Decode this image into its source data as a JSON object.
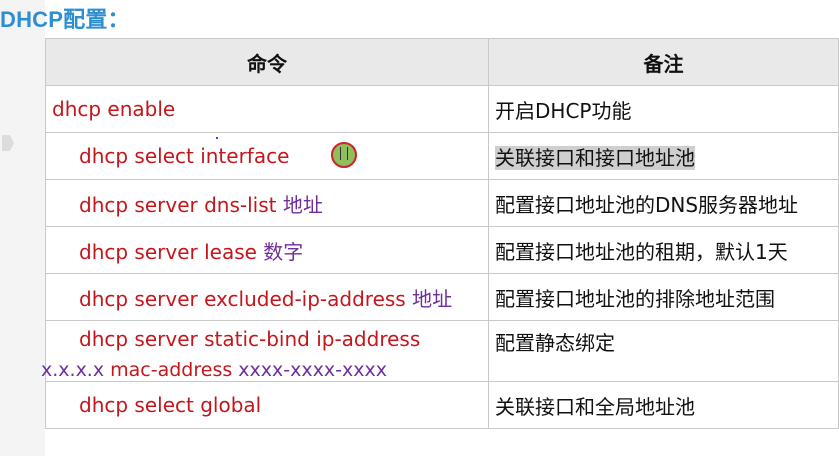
{
  "title": "DHCP配置：",
  "table": {
    "headers": {
      "command": "命令",
      "note": "备注"
    },
    "rows": [
      {
        "cmd": "dhcp enable",
        "arg": "",
        "note": "开启DHCP功能"
      },
      {
        "cmd": "dhcp select  interface",
        "arg": "",
        "note_hl": "关联接口和接口地址池"
      },
      {
        "cmd": "dhcp server dns-list ",
        "arg": "地址",
        "note": "配置接口地址池的DNS服务器地址"
      },
      {
        "cmd": "dhcp server lease ",
        "arg": "数字",
        "note": "配置接口地址池的租期，默认1天"
      },
      {
        "cmd": "dhcp server excluded-ip-address ",
        "arg": "地址",
        "note": "配置接口地址池的排除地址范围"
      },
      {
        "cmd": "dhcp server static-bind ip-address",
        "arg": "x.x.x.x",
        "cmd2": " mac-address ",
        "arg2": "xxxx-xxxx-xxxx",
        "note": "配置静态绑定"
      },
      {
        "cmd": "dhcp select global",
        "arg": "",
        "note": "关联接口和全局地址池"
      }
    ]
  },
  "colors": {
    "title": "#2e8fd0",
    "command": "#c4161c",
    "argument": "#6f2e9e"
  }
}
